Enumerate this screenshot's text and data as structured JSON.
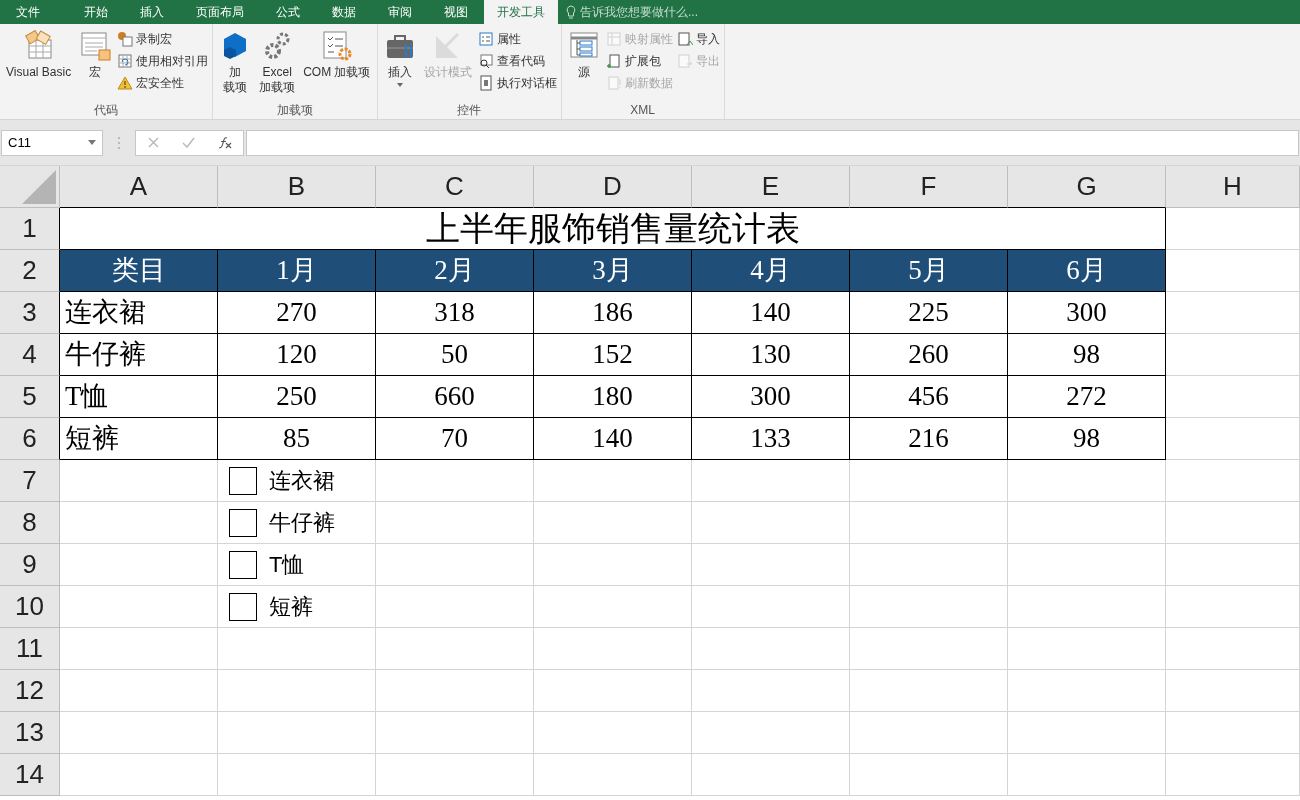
{
  "tabs": [
    {
      "label": "文件",
      "selected": false
    },
    {
      "label": "开始",
      "selected": false
    },
    {
      "label": "插入",
      "selected": false
    },
    {
      "label": "页面布局",
      "selected": false
    },
    {
      "label": "公式",
      "selected": false
    },
    {
      "label": "数据",
      "selected": false
    },
    {
      "label": "审阅",
      "selected": false
    },
    {
      "label": "视图",
      "selected": false
    },
    {
      "label": "开发工具",
      "selected": true
    }
  ],
  "tell_me": {
    "placeholder": "告诉我您想要做什么..."
  },
  "ribbon_groups": [
    {
      "label": "代码",
      "items": [
        {
          "kind": "large",
          "lines": [
            "Visual Basic"
          ],
          "disabled": false
        },
        {
          "kind": "large",
          "lines": [
            "宏"
          ],
          "disabled": false
        },
        {
          "kind": "small",
          "lines": [
            "录制宏"
          ],
          "disabled": false
        },
        {
          "kind": "small",
          "lines": [
            "使用相对引用"
          ],
          "disabled": false
        },
        {
          "kind": "small",
          "lines": [
            "宏安全性"
          ],
          "disabled": false
        }
      ]
    },
    {
      "label": "加载项",
      "items": [
        {
          "kind": "large",
          "lines": [
            "加",
            "载项"
          ],
          "disabled": false
        },
        {
          "kind": "large",
          "lines": [
            "Excel",
            "加载项"
          ],
          "disabled": false
        },
        {
          "kind": "large",
          "lines": [
            "COM 加载项"
          ],
          "disabled": false
        }
      ]
    },
    {
      "label": "控件",
      "items": [
        {
          "kind": "dropdown",
          "lines": [
            "插入"
          ],
          "disabled": false
        },
        {
          "kind": "large",
          "lines": [
            "设计模式"
          ],
          "disabled": true
        },
        {
          "kind": "small",
          "lines": [
            "属性"
          ],
          "disabled": false
        },
        {
          "kind": "small",
          "lines": [
            "查看代码"
          ],
          "disabled": false
        },
        {
          "kind": "small",
          "lines": [
            "执行对话框"
          ],
          "disabled": false
        }
      ]
    },
    {
      "label": "XML",
      "items": [
        {
          "kind": "large",
          "lines": [
            "源"
          ],
          "disabled": false
        },
        {
          "kind": "small",
          "lines": [
            "映射属性"
          ],
          "disabled": true
        },
        {
          "kind": "small",
          "lines": [
            "扩展包"
          ],
          "disabled": false
        },
        {
          "kind": "small",
          "lines": [
            "刷新数据"
          ],
          "disabled": true
        },
        {
          "kind": "small",
          "lines": [
            "导入"
          ],
          "disabled": false
        },
        {
          "kind": "small",
          "lines": [
            "导出"
          ],
          "disabled": true
        }
      ]
    }
  ],
  "name_box": "C11",
  "columns": [
    "A",
    "B",
    "C",
    "D",
    "E",
    "F",
    "G",
    "H"
  ],
  "row_numbers": [
    "1",
    "2",
    "3",
    "4",
    "5",
    "6",
    "7",
    "8",
    "9",
    "10",
    "11",
    "12",
    "13",
    "14"
  ],
  "title": "上半年服饰销售量统计表",
  "header": [
    "类目",
    "1月",
    "2月",
    "3月",
    "4月",
    "5月",
    "6月"
  ],
  "rows": [
    [
      "连衣裙",
      "270",
      "318",
      "186",
      "140",
      "225",
      "300"
    ],
    [
      "牛仔裤",
      "120",
      "50",
      "152",
      "130",
      "260",
      "98"
    ],
    [
      "T恤",
      "250",
      "660",
      "180",
      "300",
      "456",
      "272"
    ],
    [
      "短裤",
      "85",
      "70",
      "140",
      "133",
      "216",
      "98"
    ]
  ],
  "checkboxes": [
    {
      "label": "连衣裙",
      "checked": false
    },
    {
      "label": "牛仔裤",
      "checked": false
    },
    {
      "label": "T恤",
      "checked": false
    },
    {
      "label": "短裤",
      "checked": false
    }
  ]
}
